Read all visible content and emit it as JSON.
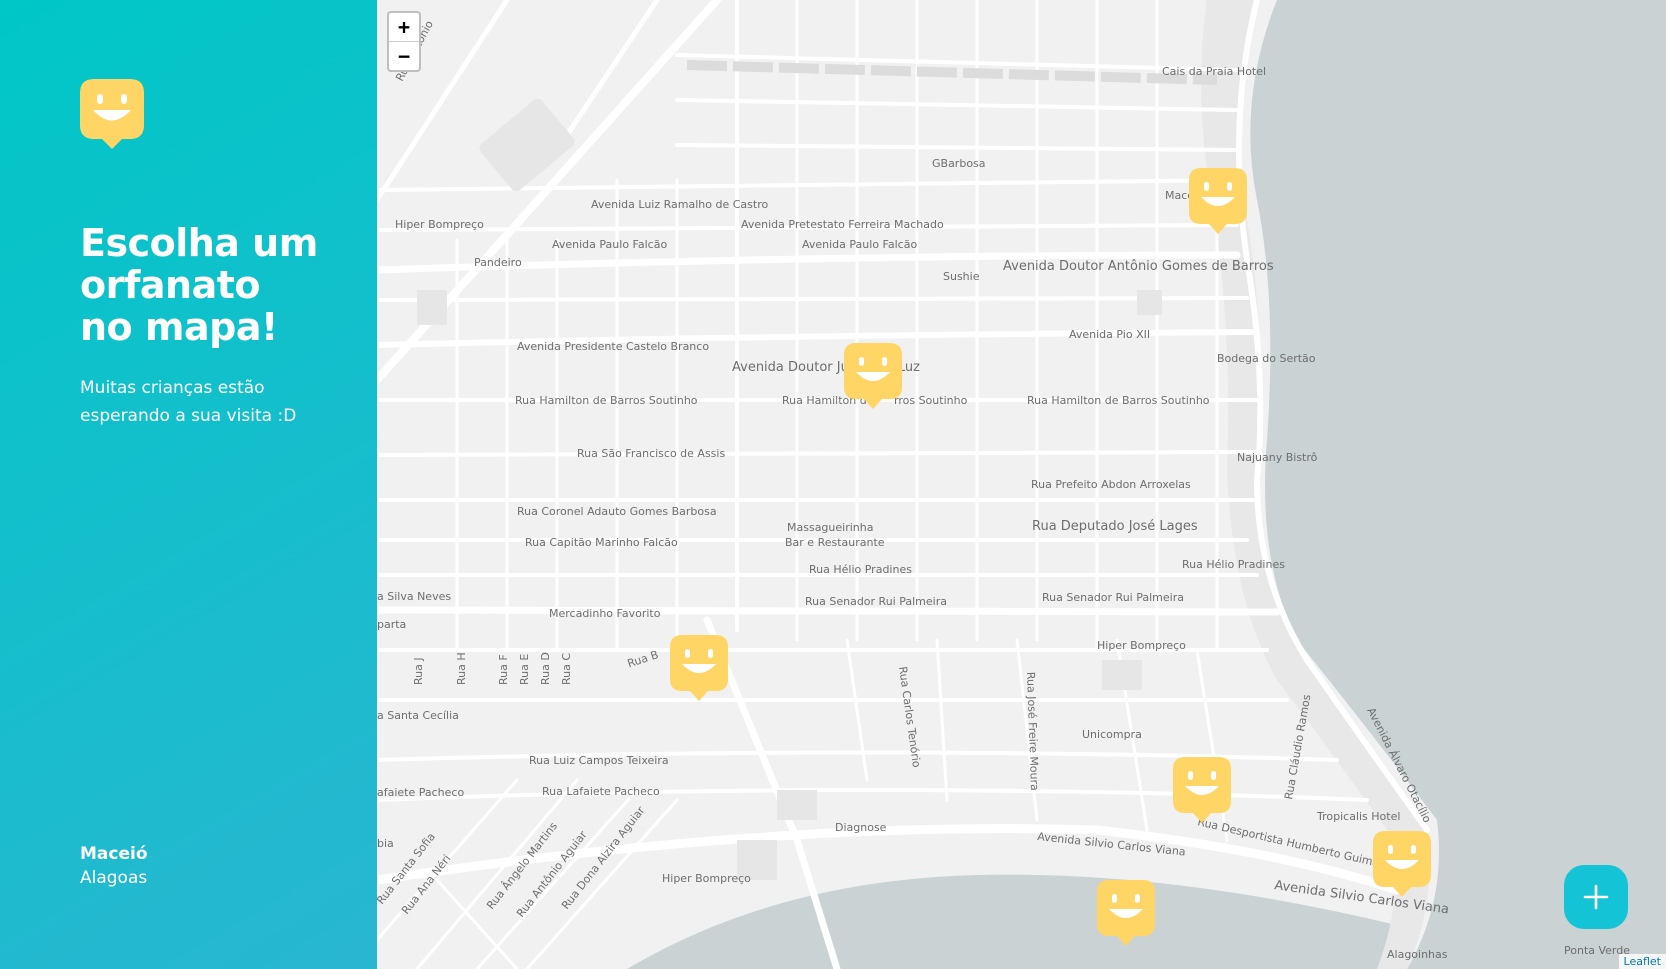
{
  "sidebar": {
    "headline_lines": [
      "Escolha um",
      "orfanato",
      "no mapa!"
    ],
    "subtitle": "Muitas crianças estão esperando a sua visita :D",
    "location": {
      "city": "Maceió",
      "state": "Alagoas"
    }
  },
  "map": {
    "zoom_in_label": "+",
    "zoom_out_label": "−",
    "attribution": "Leaflet",
    "marker_icon": "smiley-map-marker-icon",
    "markers_count": 6,
    "street_labels": {
      "caisPraiaHotel": "Cais da Praia Hotel",
      "gbarbosa": "GBarbosa",
      "maceio": "Maceió",
      "avLuizRamalho": "Avenida Luiz Ramalho de Castro",
      "avPretestato": "Avenida Pretestato Ferreira Machado",
      "hiperBompreco1": "Hiper Bompreço",
      "avPauloFalcao1": "Avenida Paulo Falcão",
      "avPauloFalcao2": "Avenida Paulo Falcão",
      "pandeiro": "Pandeiro",
      "sushie": "Sushie",
      "avDoutorAntonio": "Avenida Doutor Antônio Gomes de Barros",
      "avPioXII": "Avenida Pio XII",
      "bodegaSertao": "Bodega do Sertão",
      "avPresCastelo": "Avenida Presidente Castelo Branco",
      "avDoutorJulio_a": "Avenida Doutor Júl",
      "avDoutorJulio_b": "s Luz",
      "ruaHamilton1": "Rua Hamilton de Barros Soutinho",
      "ruaHamilton2_a": "Rua Hamilton d",
      "ruaHamilton2_b": "rros Soutinho",
      "ruaHamilton3": "Rua Hamilton de Barros Soutinho",
      "ruaSaoFrancisco": "Rua São Francisco de Assis",
      "najuanyBistro": "Najuany Bistrô",
      "ruaPrefeito": "Rua Prefeito Abdon Arroxelas",
      "ruaCoronel": "Rua Coronel Adauto Gomes Barbosa",
      "massaguerinha1": "Massagueirinha",
      "massaguerinha2": "Bar e Restaurante",
      "ruaDeputado": "Rua Deputado José Lages",
      "ruaCapitao": "Rua Capitão Marinho Falcão",
      "ruaHelio1": "Rua Hélio Pradines",
      "ruaHelio2": "Rua Hélio Pradines",
      "silvaNeves": "a Silva Neves",
      "ruaSenador1": "Rua Senador Rui Palmeira",
      "ruaSenador2": "Rua Senador Rui Palmeira",
      "parta": "parta",
      "mercadinho": "Mercadinho Favorito",
      "hiperBompreco2": "Hiper Bompreço",
      "ruaB": "Rua B",
      "ruaJ": "Rua J",
      "ruaH": "Rua H",
      "ruaF": "Rua F",
      "ruaE": "Rua E",
      "ruaD": "Rua D",
      "ruaC": "Rua C",
      "ruaCarlos": "Rua Carlos Tenório",
      "ruaJoseFreire": "Rua José Freire Moura",
      "ruaClaudio": "Rua Cláudio Ramos",
      "avAlvaro": "Avenida Álvaro Otacílio",
      "santaCecilia": "a Santa Cecília",
      "unicompra": "Unicompra",
      "ruaLuizCampos": "Rua Luiz Campos Teixeira",
      "lafaiete1": "afaiete Pacheco",
      "lafaiete2": "Rua Lafaiete Pacheco",
      "tropicalis": "Tropicalis Hotel",
      "diagnose": "Diagnose",
      "avSilvio1": "Avenida Silvio Carlos Viana",
      "ruaDesportista": "Rua Desportista Humberto Guimarães",
      "avSilvio2": "Avenida Silvio Carlos Viana",
      "ruaSantaSofia": "Rua Santa Sofia",
      "ruaAnaNeri": "Rua Ana Néri",
      "ruaAngelo": "Rua Ângelo Martins",
      "ruaAntonioAguiar": "Rua Antônio Aguiar",
      "ruaDonaAlzira": "Rua Dona Alzira Aguiar",
      "hiperBompreco3": "Hiper Bompreço",
      "bia": "bia",
      "ruaAntonioTop": "Rua Antônio",
      "alagoinhas": "Alagoinhas",
      "pontaVerde": "Ponta Verde"
    }
  },
  "fab": {
    "icon": "plus-icon"
  },
  "colors": {
    "sidebar_gradient_start": "#00C7C7",
    "sidebar_gradient_end": "#29B6D1",
    "marker_yellow": "#FFD666",
    "fab": "#15C3D6",
    "water": "#cad2d3"
  }
}
